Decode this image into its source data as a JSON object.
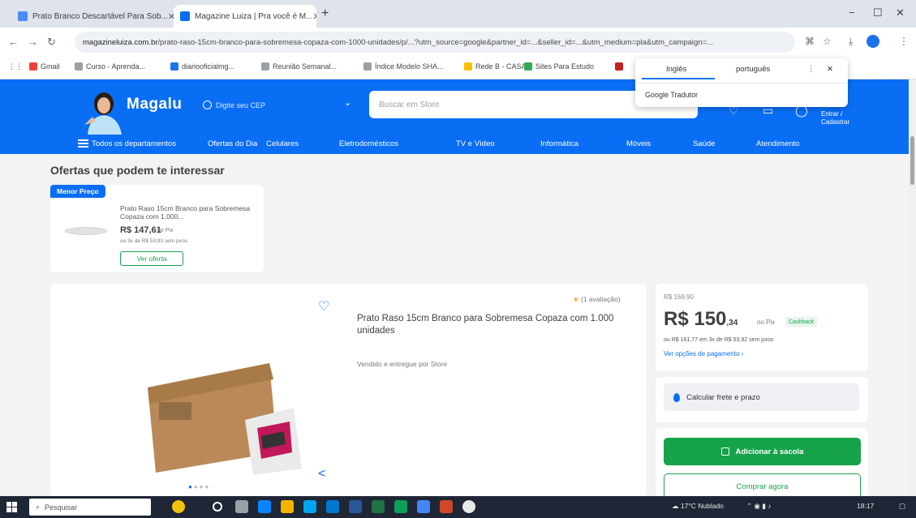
{
  "browser": {
    "tabs": [
      {
        "title": "Prato Branco Descartável Para Sob..."
      },
      {
        "title": "Magazine Luiza | Pra você é M..."
      }
    ],
    "url_host": "magazineluiza.com.br",
    "url_rest": "/prato-raso-15cm-branco-para-sobremesa-copaza-com-1000-unidades/p/...?utm_source=google&partner_id=...&seller_id=...&utm_medium=pla&utm_campaign=...",
    "bookmarks": [
      "Gmail",
      "Curso - Aprenda...",
      "diariooficialmg...",
      "Reunião Semanal...",
      "Índice Modelo SHA...",
      "Rede B - CASA",
      "Sites Para Estudo"
    ]
  },
  "translate_popup": {
    "tab_source": "Inglês",
    "tab_target": "português",
    "item": "Google Tradutor"
  },
  "header": {
    "logo": "Magalu",
    "cep_text": "Digite seu CEP",
    "search_placeholder": "Buscar em Store",
    "login_text": "Entrar / Cadastrar",
    "menu": [
      "Todos os departamentos",
      "Ofertas do Dia",
      "Celulares",
      "Eletrodomésticos",
      "TV e Vídeo",
      "Informática",
      "Móveis",
      "Saúde",
      "Atendimento"
    ]
  },
  "offers": {
    "title": "Ofertas que podem te interessar",
    "badge": "Menor Preço",
    "name": "Prato Raso 15cm Branco para Sobremesa Copaza com 1.000...",
    "price": "R$ 147,61",
    "price_suffix": "no Pix",
    "installments": "ou 3x de R$ 53,93 sem juros",
    "button": "Ver oferta"
  },
  "product": {
    "rating": "(1 avaliação)",
    "title": "Prato Raso 15cm Branco para Sobremesa Copaza com 1.000 unidades",
    "seller": "Vendido e entregue por Store"
  },
  "price_box": {
    "old_price": "R$ 169,90",
    "price_main": "R$ 150",
    "price_cents": ",34",
    "price_suffix": "no Pix",
    "pix_badge": "Cashback",
    "installments": "ou R$ 161,77 em 3x de R$ 53,92 sem juros",
    "payment_link": "Ver opções de pagamento"
  },
  "shipping": {
    "label": "Calcular frete e prazo"
  },
  "actions": {
    "add_cart": "Adicionar à sacola",
    "buy_now": "Comprar agora"
  },
  "taskbar": {
    "search": "Pesquisar",
    "weather": "17°C Nublado",
    "time": "18:17"
  },
  "colors": {
    "brand_blue": "#0a6ef5",
    "green": "#16a34a"
  }
}
